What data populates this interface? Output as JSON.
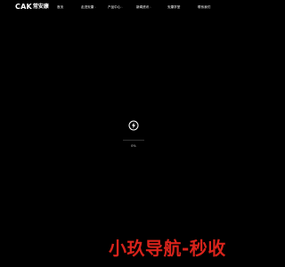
{
  "header": {
    "logo_text": "CAK",
    "logo_cn": "常安康",
    "nav": [
      {
        "label": "首页",
        "has_dropdown": false
      },
      {
        "label": "走进安康",
        "has_dropdown": true
      },
      {
        "label": "产品中心",
        "has_dropdown": true
      },
      {
        "label": "新闻资讯",
        "has_dropdown": true
      },
      {
        "label": "安康学堂",
        "has_dropdown": false
      },
      {
        "label": "联系我们",
        "has_dropdown": false
      }
    ],
    "chevron": "›"
  },
  "loader": {
    "icon": "lightning-bolt-circle-icon",
    "progress": 0,
    "percent_text": "0%"
  },
  "watermark": {
    "text": "小玖导航-秒收"
  },
  "colors": {
    "background": "#000000",
    "text": "#ffffff",
    "watermark": "#d8231b"
  }
}
